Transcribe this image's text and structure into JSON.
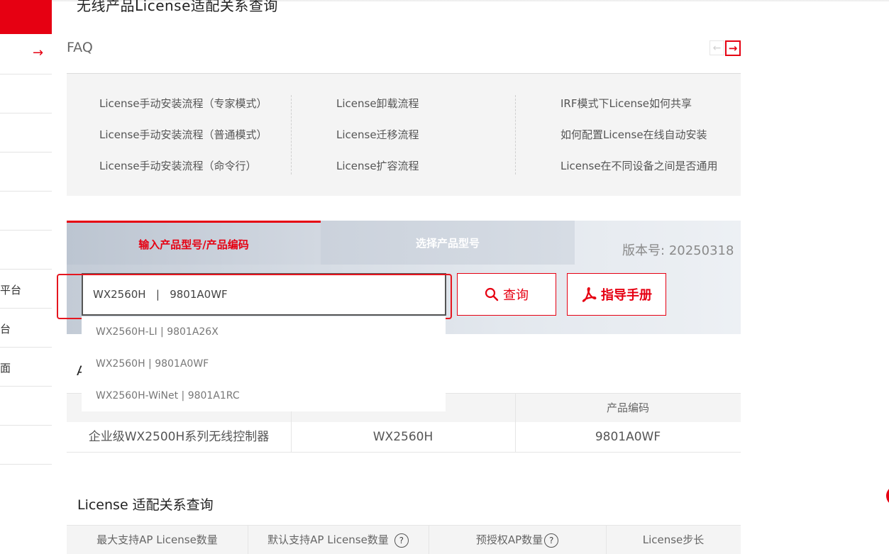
{
  "page": {
    "title": "无线产品License适配关系查询"
  },
  "sidebar": {
    "arrow_icon": "arrow-right-icon",
    "items": [
      "",
      "",
      "",
      "",
      "",
      "平台",
      "台",
      "面",
      "",
      ""
    ]
  },
  "faq": {
    "title": "FAQ",
    "prev_icon": "chevron-left-icon",
    "next_icon": "arrow-right-icon",
    "columns": [
      [
        "License手动安装流程（专家模式）",
        "License手动安装流程（普通模式）",
        "License手动安装流程（命令行）"
      ],
      [
        "License卸载流程",
        "License迁移流程",
        "License扩容流程"
      ],
      [
        "IRF模式下License如何共享",
        "如何配置License在线自动安装",
        "License在不同设备之间是否通用"
      ]
    ]
  },
  "search": {
    "tabs": [
      "输入产品型号/产品编码",
      "选择产品型号"
    ],
    "active_tab": 0,
    "version_label": "版本号:",
    "version_value": "20250318",
    "input_value": "WX2560H   |   9801A0WF",
    "query_button": "查询",
    "guide_button": "指导手册",
    "suggestions": [
      "WX2560H-LI | 9801A26X",
      "WX2560H | 9801A0WF",
      "WX2560H-WiNet | 9801A1RC"
    ],
    "accent_color": "#e60012"
  },
  "product_table": {
    "section_title_visible": "A",
    "headers": [
      "",
      "",
      "产品编码"
    ],
    "row": [
      "企业级WX2500H系列无线控制器",
      "WX2560H",
      "9801A0WF"
    ]
  },
  "license": {
    "title": "License 适配关系查询",
    "headers": [
      "最大支持AP License数量",
      "默认支持AP License数量",
      "预授权AP数量",
      "License步长"
    ]
  }
}
